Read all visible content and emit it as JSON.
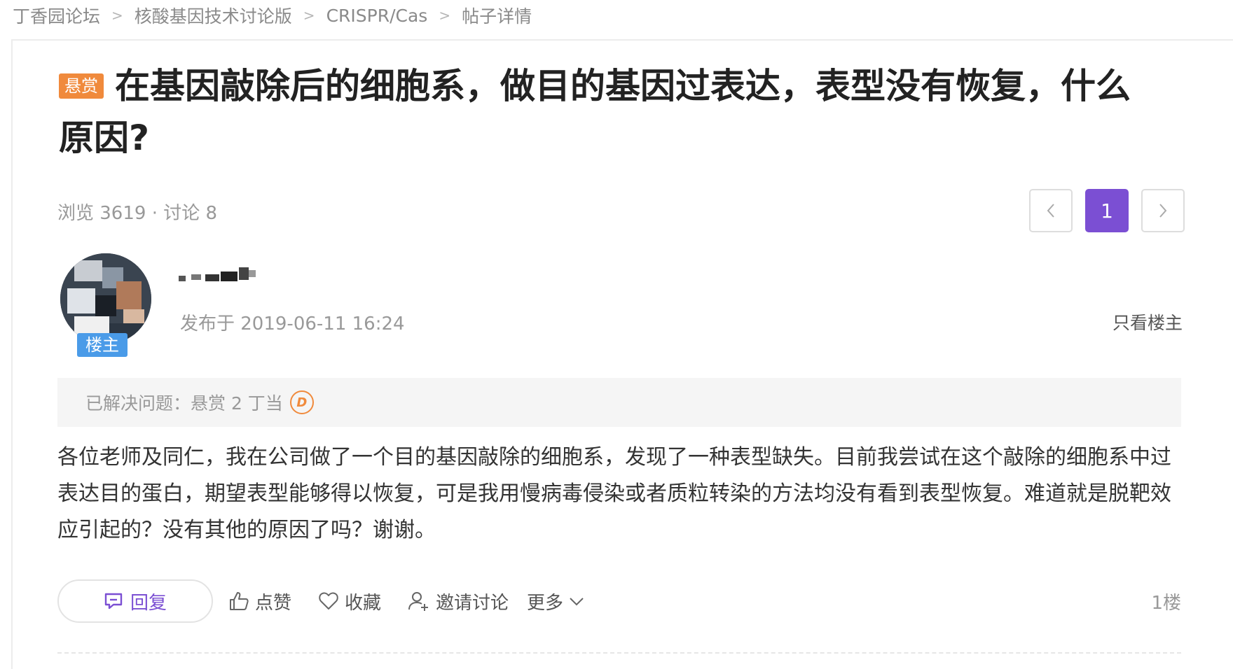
{
  "breadcrumb": {
    "items": [
      "丁香园论坛",
      "核酸基因技术讨论版",
      "CRISPR/Cas",
      "帖子详情"
    ],
    "separator": ">"
  },
  "post": {
    "bounty_tag": "悬赏",
    "title": "在基因敲除后的细胞系，做目的基因过表达，表型没有恢复，什么原因?",
    "stats": "浏览 3619 · 讨论 8",
    "author_badge": "楼主",
    "published": "发布于 2019-06-11 16:24",
    "only_owner": "只看楼主",
    "solved": "已解决问题：悬赏 2 丁当",
    "coin_icon_glyph": "D",
    "content": "各位老师及同仁，我在公司做了一个目的基因敲除的细胞系，发现了一种表型缺失。目前我尝试在这个敲除的细胞系中过表达目的蛋白，期望表型能够得以恢复，可是我用慢病毒侵染或者质粒转染的方法均没有看到表型恢复。难道就是脱靶效应引起的？没有其他的原因了吗？谢谢。",
    "floor": "1楼"
  },
  "pager": {
    "prev": "<",
    "current": "1",
    "next": ">"
  },
  "actions": {
    "reply": "回复",
    "like": "点赞",
    "favorite": "收藏",
    "invite": "邀请讨论",
    "more": "更多"
  },
  "colors": {
    "accent": "#7b4fd3",
    "bounty": "#f08a3c",
    "badge": "#4a9be8"
  }
}
